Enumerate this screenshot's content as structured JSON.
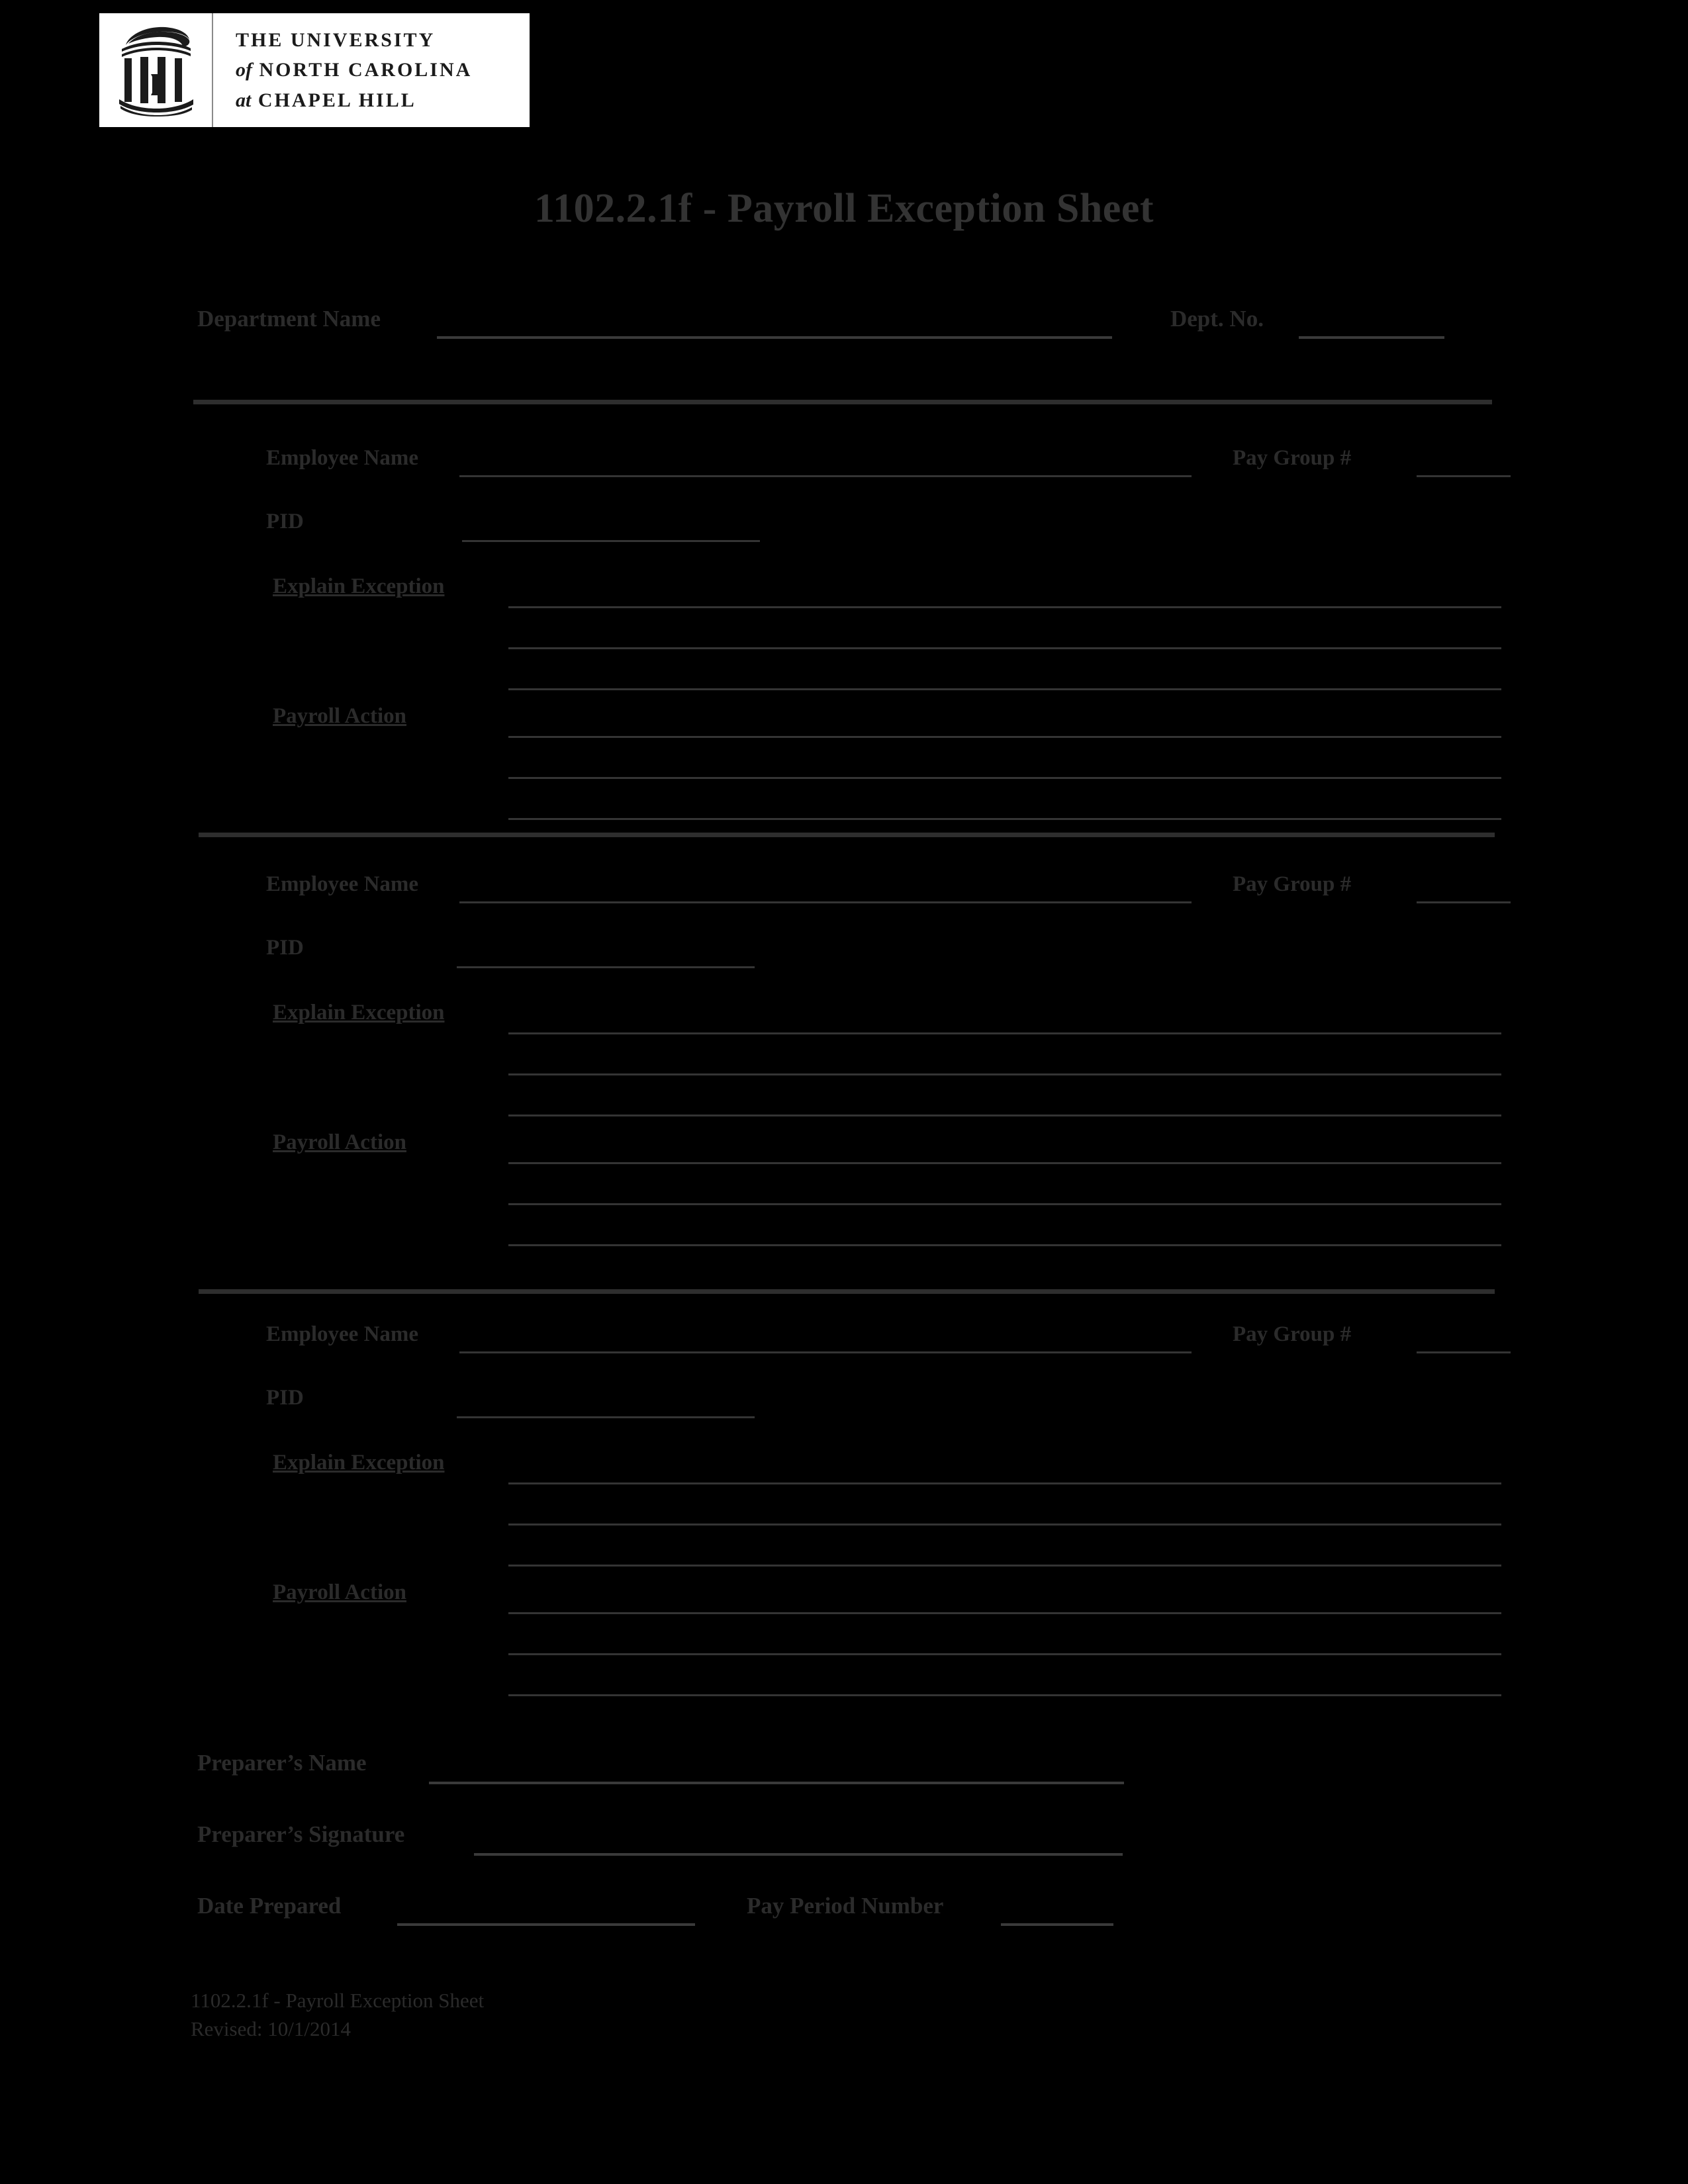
{
  "logo": {
    "icon": "old-well-rotunda-icon",
    "line1": "THE UNIVERSITY",
    "line2_italic": "of",
    "line2": "NORTH CAROLINA",
    "line3_italic": "at",
    "line3": "CHAPEL HILL"
  },
  "title": "1102.2.1f - Payroll Exception Sheet",
  "header": {
    "department_name_label": "Department Name",
    "department_name_value": "",
    "dept_no_label": "Dept. No.",
    "dept_no_value": ""
  },
  "employee_labels": {
    "employee_name": "Employee Name",
    "pay_group": "Pay Group #",
    "pid": "PID",
    "explain_exception": "Explain Exception",
    "payroll_action": "Payroll Action"
  },
  "sections": [
    {
      "employee_name_value": "",
      "pay_group_value": "",
      "pid_value": "",
      "explain_exception_lines": [
        "",
        "",
        ""
      ],
      "payroll_action_lines": [
        "",
        "",
        ""
      ]
    },
    {
      "employee_name_value": "",
      "pay_group_value": "",
      "pid_value": "",
      "explain_exception_lines": [
        "",
        "",
        ""
      ],
      "payroll_action_lines": [
        "",
        "",
        ""
      ]
    },
    {
      "employee_name_value": "",
      "pay_group_value": "",
      "pid_value": "",
      "explain_exception_lines": [
        "",
        "",
        ""
      ],
      "payroll_action_lines": [
        "",
        "",
        ""
      ]
    }
  ],
  "footer_fields": {
    "preparer_name_label": "Preparer’s Name",
    "preparer_name_value": "",
    "preparer_signature_label": "Preparer’s Signature",
    "preparer_signature_value": "",
    "date_prepared_label": "Date Prepared",
    "date_prepared_value": "",
    "pay_period_number_label": "Pay Period Number",
    "pay_period_number_value": ""
  },
  "footer": {
    "line1": "1102.2.1f - Payroll Exception Sheet",
    "line2": "Revised: 10/1/2014"
  },
  "colors": {
    "background": "#000000",
    "text": "#2b2b2b",
    "title": "#333333",
    "rule": "#3a3a3a",
    "logo_background": "#ffffff",
    "logo_ink": "#1b1b1b"
  }
}
